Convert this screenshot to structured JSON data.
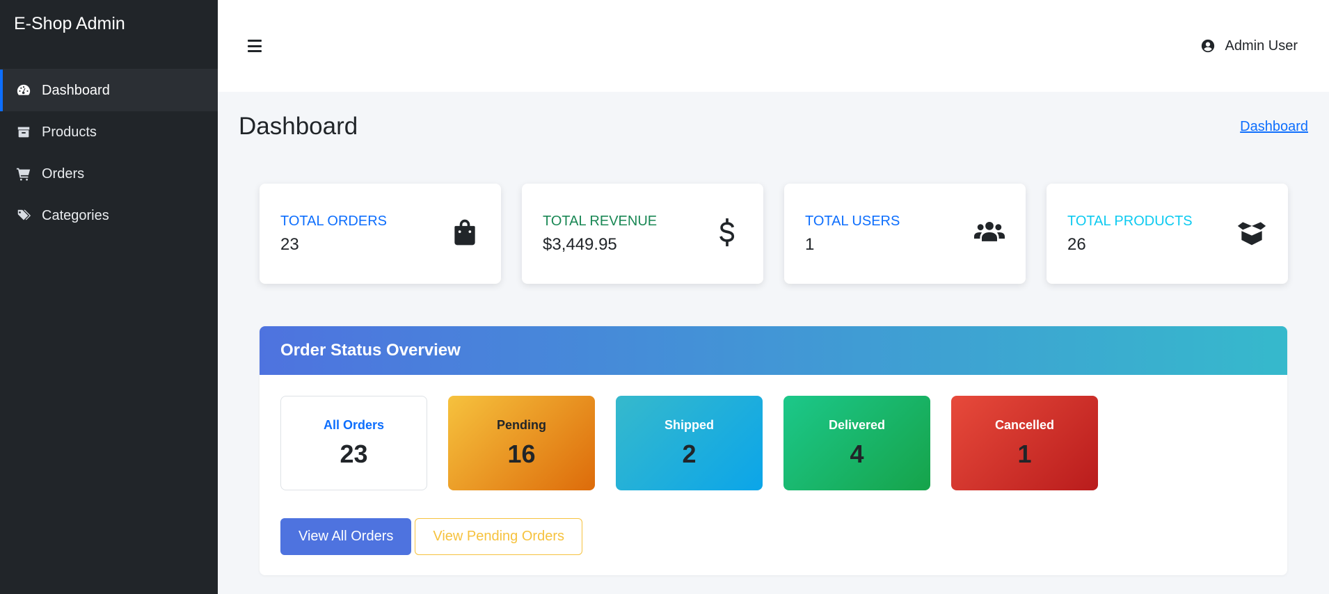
{
  "app": {
    "title": "E-Shop Admin"
  },
  "sidebar": {
    "items": [
      {
        "label": "Dashboard",
        "icon": "gauge-icon",
        "active": true
      },
      {
        "label": "Products",
        "icon": "box-icon",
        "active": false
      },
      {
        "label": "Orders",
        "icon": "cart-icon",
        "active": false
      },
      {
        "label": "Categories",
        "icon": "tags-icon",
        "active": false
      }
    ]
  },
  "topbar": {
    "user_name": "Admin User",
    "menu_icon": "hamburger-icon",
    "user_icon": "user-circle-icon"
  },
  "page": {
    "title": "Dashboard",
    "breadcrumb": "Dashboard"
  },
  "stats": [
    {
      "label": "TOTAL ORDERS",
      "value": "23",
      "color": "#0d6efd",
      "icon": "shopping-bag-icon"
    },
    {
      "label": "TOTAL REVENUE",
      "value": "$3,449.95",
      "color": "#198754",
      "icon": "dollar-icon"
    },
    {
      "label": "TOTAL USERS",
      "value": "1",
      "color": "#0d6efd",
      "icon": "users-icon"
    },
    {
      "label": "TOTAL PRODUCTS",
      "value": "26",
      "color": "#0dcaf0",
      "icon": "open-box-icon"
    }
  ],
  "order_status": {
    "title": "Order Status Overview",
    "boxes": [
      {
        "label": "All Orders",
        "count": "23"
      },
      {
        "label": "Pending",
        "count": "16"
      },
      {
        "label": "Shipped",
        "count": "2"
      },
      {
        "label": "Delivered",
        "count": "4"
      },
      {
        "label": "Cancelled",
        "count": "1"
      }
    ],
    "buttons": {
      "view_all": "View All Orders",
      "view_pending": "View Pending Orders"
    }
  },
  "colors": {
    "sidebar_bg": "#212529",
    "accent": "#0d6efd",
    "header_gradient_start": "#4e73df",
    "header_gradient_end": "#36b9cc"
  }
}
